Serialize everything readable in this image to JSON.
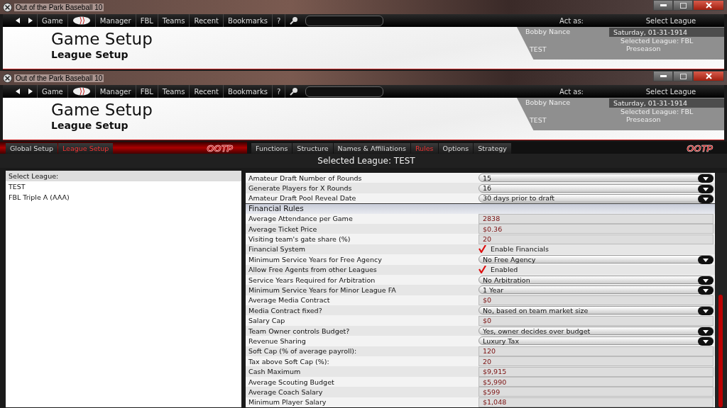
{
  "windows": [
    {
      "title": "Out of the Park Baseball 10",
      "menu": [
        "Game",
        "Manager",
        "FBL",
        "Teams",
        "Recent",
        "Bookmarks",
        "?"
      ],
      "act_as": "Act as:",
      "select_league": "Select League",
      "heading": "Game Setup",
      "subheading": "League Setup",
      "info": {
        "manager": "Bobby Nance",
        "date": "Saturday, 01-31-1914",
        "league": "Selected League: FBL",
        "team": "TEST",
        "phase": "Preseason"
      }
    },
    {
      "title": "Out of the Park Baseball 10",
      "menu": [
        "Game",
        "Manager",
        "FBL",
        "Teams",
        "Recent",
        "Bookmarks",
        "?"
      ],
      "act_as": "Act as:",
      "select_league": "Select League",
      "heading": "Game Setup",
      "subheading": "League Setup",
      "info": {
        "manager": "Bobby Nance",
        "date": "Saturday, 01-31-1914",
        "league": "Selected League: FBL",
        "team": "TEST",
        "phase": "Preseason"
      }
    }
  ],
  "left_tabs": [
    {
      "label": "Global Setup",
      "selected": false
    },
    {
      "label": "League Setup",
      "selected": true
    }
  ],
  "right_tabs": [
    {
      "label": "Functions",
      "selected": false
    },
    {
      "label": "Structure",
      "selected": false
    },
    {
      "label": "Names & Affiliations",
      "selected": false
    },
    {
      "label": "Rules",
      "selected": true
    },
    {
      "label": "Options",
      "selected": false
    },
    {
      "label": "Strategy",
      "selected": false
    }
  ],
  "logos": [
    "OOTP",
    "OOTP"
  ],
  "selected_league": "Selected League: TEST",
  "league_list": {
    "header": "Select League:",
    "items": [
      {
        "label": "TEST",
        "selected": false
      },
      {
        "label": "FBL Triple A (AAA)",
        "selected": false
      }
    ]
  },
  "rules": [
    {
      "kind": "dropdown",
      "label": "Amateur Draft Number of Rounds",
      "value": "15"
    },
    {
      "kind": "dropdown",
      "label": "Generate Players for X Rounds",
      "value": "16"
    },
    {
      "kind": "dropdown",
      "label": "Amateur Draft Pool Reveal Date",
      "value": "30 days prior to draft"
    },
    {
      "kind": "section",
      "label": "Financial Rules"
    },
    {
      "kind": "text",
      "label": "Average Attendance per Game",
      "value": "2838"
    },
    {
      "kind": "text",
      "label": "Average Ticket Price",
      "value": "$0.36"
    },
    {
      "kind": "text",
      "label": "Visiting team's gate share (%)",
      "value": "20"
    },
    {
      "kind": "checkbox",
      "label": "Financial System",
      "value": "Enable Financials",
      "checked": true
    },
    {
      "kind": "dropdown",
      "label": "Minimum Service Years for Free Agency",
      "value": "No Free Agency"
    },
    {
      "kind": "checkbox",
      "label": "Allow Free Agents from other Leagues",
      "value": "Enabled",
      "checked": true
    },
    {
      "kind": "dropdown",
      "label": "Service Years Required for Arbitration",
      "value": "No Arbitration"
    },
    {
      "kind": "dropdown",
      "label": "Minimum Service Years for Minor League FA",
      "value": "1 Year"
    },
    {
      "kind": "text",
      "label": "Average Media Contract",
      "value": "$0"
    },
    {
      "kind": "dropdown",
      "label": "Media Contract fixed?",
      "value": "No, based on team market size"
    },
    {
      "kind": "text",
      "label": "Salary Cap",
      "value": "$0"
    },
    {
      "kind": "dropdown",
      "label": "Team Owner controls Budget?",
      "value": "Yes, owner decides over budget"
    },
    {
      "kind": "dropdown",
      "label": "Revenue Sharing",
      "value": "Luxury Tax"
    },
    {
      "kind": "text",
      "label": "Soft Cap (% of average payroll):",
      "value": "120"
    },
    {
      "kind": "text",
      "label": "Tax above Soft Cap (%):",
      "value": "20"
    },
    {
      "kind": "text",
      "label": "Cash Maximum",
      "value": "$9,915"
    },
    {
      "kind": "text",
      "label": "Average Scouting Budget",
      "value": "$5,990"
    },
    {
      "kind": "text",
      "label": "Average Coach Salary",
      "value": "$599"
    },
    {
      "kind": "text",
      "label": "Minimum Player Salary",
      "value": "$1,048"
    }
  ]
}
